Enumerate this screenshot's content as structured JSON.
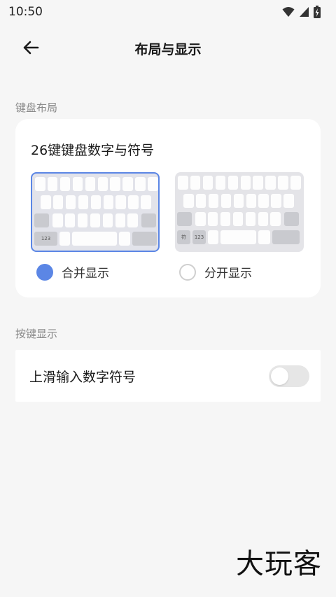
{
  "status_bar": {
    "time": "10:50"
  },
  "header": {
    "title": "布局与显示"
  },
  "keyboard_layout_section": {
    "label": "键盘布局",
    "card_title": "26键键盘数字与符号",
    "options": [
      {
        "label": "合并显示",
        "selected": true,
        "keys": [
          "123"
        ]
      },
      {
        "label": "分开显示",
        "selected": false,
        "keys": [
          "符",
          "123"
        ]
      }
    ]
  },
  "key_display_section": {
    "label": "按键显示",
    "swipe_up_label": "上滑输入数字符号",
    "swipe_up_enabled": false
  },
  "watermark": "大玩客",
  "colors": {
    "accent": "#5b86e5",
    "background": "#f6f6f6",
    "card": "#ffffff"
  }
}
